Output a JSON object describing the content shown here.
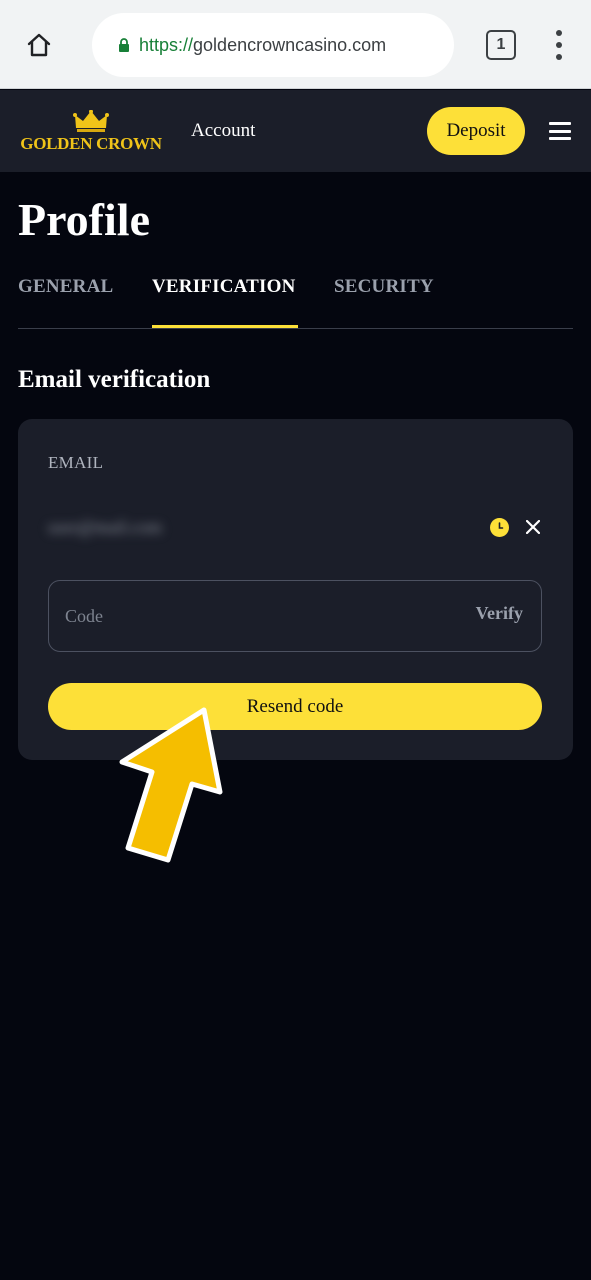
{
  "browser": {
    "url_scheme": "https://",
    "url_host": "goldencrowncasino.com",
    "tab_count": "1"
  },
  "header": {
    "logo_text": "GOLDEN CROWN",
    "nav_account": "Account",
    "deposit_label": "Deposit"
  },
  "page": {
    "title": "Profile",
    "tabs": [
      {
        "label": "GENERAL",
        "active": false
      },
      {
        "label": "VERIFICATION",
        "active": true
      },
      {
        "label": "SECURITY",
        "active": false
      }
    ],
    "section_title": "Email verification"
  },
  "email_card": {
    "label": "EMAIL",
    "email_value": "user@mail.com",
    "status": "pending",
    "code_placeholder": "Code",
    "verify_label": "Verify",
    "resend_label": "Resend code"
  },
  "colors": {
    "accent": "#fde038",
    "background": "#04060f",
    "card": "#1b1e29",
    "logo_gold": "#f0c419"
  },
  "icons": [
    "home-icon",
    "lock-icon",
    "tabs-icon",
    "more-vert-icon",
    "crown-icon",
    "hamburger-icon",
    "clock-icon",
    "close-icon",
    "arrow-pointer-icon"
  ]
}
